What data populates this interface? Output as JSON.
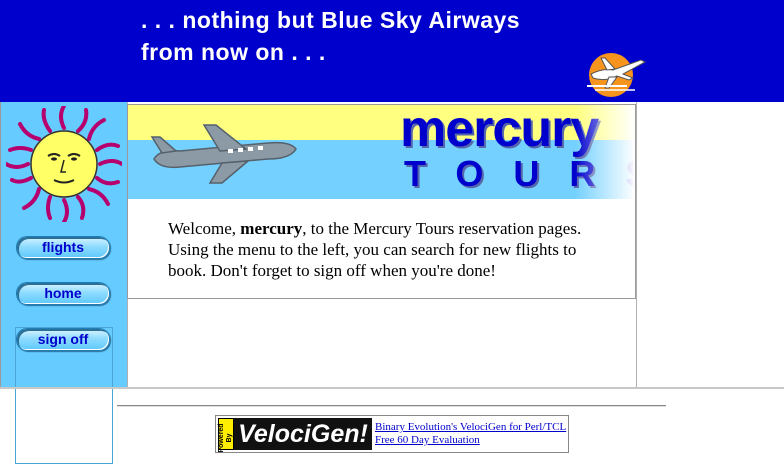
{
  "banner": {
    "line1": ". . . nothing but Blue Sky Airways",
    "line2": "from now on . . .",
    "background_color": "#0000cc",
    "logo_icon": "airplane-over-sun-icon"
  },
  "sidebar": {
    "background_color": "#66ccff",
    "logo_icon": "sun-face-icon",
    "nav": [
      {
        "label": "flights"
      },
      {
        "label": "home"
      },
      {
        "label": "sign off"
      }
    ]
  },
  "hero": {
    "brand": "mercury",
    "subtitle": "TOURS",
    "plane_icon": "airplane-icon"
  },
  "welcome": {
    "prefix": "Welcome, ",
    "username": "mercury",
    "suffix": ", to the Mercury Tours reservation pages. Using the menu to the left, you can search for new flights to book. Don't forget to sign off when you're done!"
  },
  "footer": {
    "powered_by": "Powered By",
    "logo_text": "VelociGen!",
    "links": [
      "Binary Evolution's VelociGen for Perl/TCL",
      "Free 60 Day Evaluation"
    ]
  }
}
